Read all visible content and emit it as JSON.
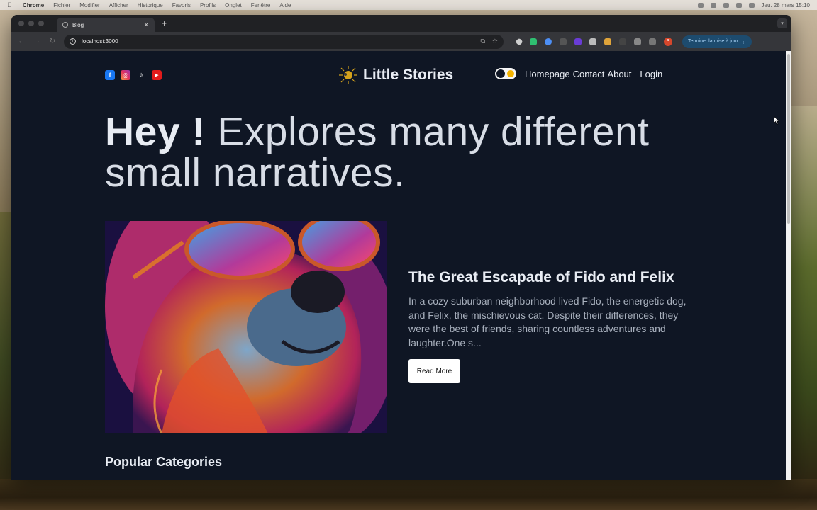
{
  "menubar": {
    "app": "Chrome",
    "items": [
      "Fichier",
      "Modifier",
      "Afficher",
      "Historique",
      "Favoris",
      "Profils",
      "Onglet",
      "Fenêtre",
      "Aide"
    ],
    "clock": "Jeu. 28 mars  15:10"
  },
  "browser": {
    "tab_title": "Blog",
    "url": "localhost:3000",
    "update_label": "Terminer la mise à jour",
    "profile_initial": "S"
  },
  "site": {
    "logo_text": "Little Stories",
    "nav": {
      "homepage": "Homepage",
      "contact": "Contact",
      "about": "About",
      "login": "Login"
    },
    "hero_bold": "Hey !",
    "hero_rest": " Explores many different small narratives.",
    "featured": {
      "title": "The Great Escapade of Fido and Felix",
      "excerpt": "In a cozy suburban neighborhood lived Fido, the energetic dog, and Felix, the mischievous cat. Despite their differences, they were the best of friends, sharing countless adventures and laughter.One s...",
      "button": "Read More"
    },
    "popular_title": "Popular Categories"
  },
  "colors": {
    "page_bg": "#0f1624",
    "text_primary": "#e8ecf3",
    "text_muted": "#a8b0bd",
    "toggle_sun": "#f5b400"
  }
}
